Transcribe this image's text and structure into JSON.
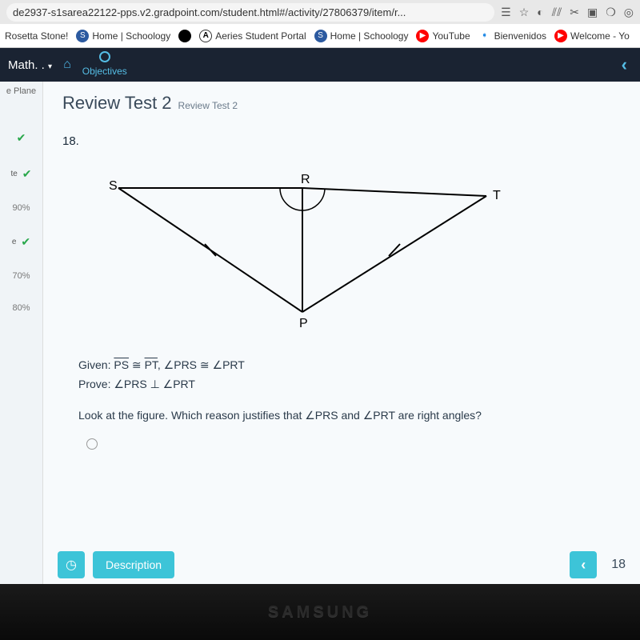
{
  "chrome": {
    "url": "de2937-s1sarea22122-pps.v2.gradpoint.com/student.html#/activity/27806379/item/r...",
    "star": "☆"
  },
  "bookmarks": {
    "b1": "Rosetta Stone!",
    "b2": "Home | Schoology",
    "b3": "Aeries Student Portal",
    "b4": "Home | Schoology",
    "b5": "YouTube",
    "b6": "Bienvenidos",
    "b7": "Welcome - Yo"
  },
  "header": {
    "title": "Math. .",
    "caret": "▾",
    "objectives": "Objectives"
  },
  "sidebar": {
    "top": "e Plane",
    "te": "te",
    "p1": "90%",
    "e": "e",
    "p2": "70%",
    "p3": "80%"
  },
  "content": {
    "title": "Review Test 2",
    "subtitle": "Review Test 2",
    "qnum": "18.",
    "labels": {
      "S": "S",
      "R": "R",
      "T": "T",
      "P": "P"
    },
    "given_label": "Given: ",
    "given_text1": "PS",
    "given_cong": " ≅ ",
    "given_text2": "PT",
    "given_comma": ", ∠PRS ≅ ∠PRT",
    "prove_label": "Prove: ",
    "prove_text": "∠PRS ⊥ ∠PRT",
    "question": "Look at the figure. Which reason justifies that ∠PRS and ∠PRT are right angles?"
  },
  "footer": {
    "clock": "◷",
    "desc": "Description",
    "prev": "‹",
    "count": "18"
  },
  "bezel": {
    "brand": "SAMSUNG"
  }
}
